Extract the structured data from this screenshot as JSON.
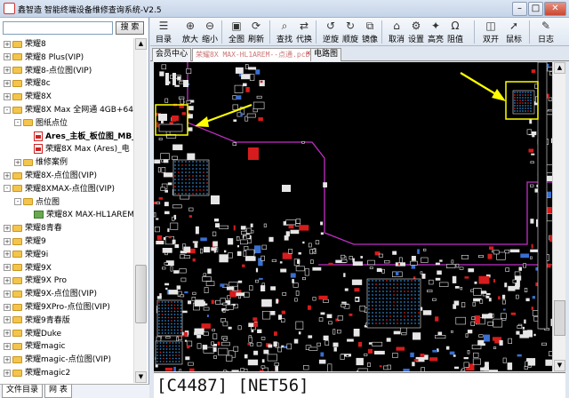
{
  "window": {
    "title": "鑫智造 智能终端设备维修查询系统-V2.5",
    "controls": {
      "minimize": "–",
      "maximize": "□",
      "close": "✕"
    }
  },
  "sidebar": {
    "search_placeholder": "",
    "search_button": "搜 索",
    "tree": [
      {
        "label": "荣耀8",
        "indent": 0,
        "icon": "folder",
        "expand": "+"
      },
      {
        "label": "荣耀8 Plus(VIP)",
        "indent": 0,
        "icon": "folder",
        "expand": "+"
      },
      {
        "label": "荣耀8-点位图(VIP)",
        "indent": 0,
        "icon": "folder",
        "expand": "+"
      },
      {
        "label": "荣耀8c",
        "indent": 0,
        "icon": "folder",
        "expand": "+"
      },
      {
        "label": "荣耀8X",
        "indent": 0,
        "icon": "folder",
        "expand": "+"
      },
      {
        "label": "荣耀8X Max 全网通 4GB+64G",
        "indent": 0,
        "icon": "folder",
        "expand": "-"
      },
      {
        "label": "图纸点位",
        "indent": 1,
        "icon": "folder",
        "expand": "-"
      },
      {
        "label": "Ares_主板_板位图_MB_V",
        "indent": 2,
        "icon": "pdf",
        "expand": "",
        "bold": true
      },
      {
        "label": "荣耀8X Max (Ares)_电",
        "indent": 2,
        "icon": "pdf",
        "expand": ""
      },
      {
        "label": "维修案例",
        "indent": 1,
        "icon": "folder",
        "expand": "+"
      },
      {
        "label": "荣耀8X-点位图(VIP)",
        "indent": 0,
        "icon": "folder",
        "expand": "+"
      },
      {
        "label": "荣耀8XMAX-点位图(VIP)",
        "indent": 0,
        "icon": "folder",
        "expand": "-"
      },
      {
        "label": "点位图",
        "indent": 1,
        "icon": "folder",
        "expand": "-"
      },
      {
        "label": "荣耀8X MAX-HL1AREM",
        "indent": 2,
        "icon": "pcb",
        "expand": ""
      },
      {
        "label": "荣耀8青春",
        "indent": 0,
        "icon": "folder",
        "expand": "+"
      },
      {
        "label": "荣耀9",
        "indent": 0,
        "icon": "folder",
        "expand": "+"
      },
      {
        "label": "荣耀9i",
        "indent": 0,
        "icon": "folder",
        "expand": "+"
      },
      {
        "label": "荣耀9X",
        "indent": 0,
        "icon": "folder",
        "expand": "+"
      },
      {
        "label": "荣耀9X Pro",
        "indent": 0,
        "icon": "folder",
        "expand": "+"
      },
      {
        "label": "荣耀9X-点位图(VIP)",
        "indent": 0,
        "icon": "folder",
        "expand": "+"
      },
      {
        "label": "荣耀9XPro-点位图(VIP)",
        "indent": 0,
        "icon": "folder",
        "expand": "+"
      },
      {
        "label": "荣耀9青春版",
        "indent": 0,
        "icon": "folder",
        "expand": "+"
      },
      {
        "label": "荣耀Duke",
        "indent": 0,
        "icon": "folder",
        "expand": "+"
      },
      {
        "label": "荣耀magic",
        "indent": 0,
        "icon": "folder",
        "expand": "+"
      },
      {
        "label": "荣耀magic-点位图(VIP)",
        "indent": 0,
        "icon": "folder",
        "expand": "+"
      },
      {
        "label": "荣耀magic2",
        "indent": 0,
        "icon": "folder",
        "expand": "+"
      }
    ],
    "tabs": [
      "文件目录",
      "网 表"
    ]
  },
  "toolbar": {
    "buttons": [
      {
        "label": "目录",
        "icon": "list-icon"
      },
      {
        "label": "放大",
        "icon": "zoom-in-icon"
      },
      {
        "label": "缩小",
        "icon": "zoom-out-icon"
      },
      {
        "label": "全图",
        "icon": "fit-icon"
      },
      {
        "label": "刷新",
        "icon": "refresh-icon"
      },
      {
        "label": "查找",
        "icon": "find-icon"
      },
      {
        "label": "代换",
        "icon": "replace-icon"
      },
      {
        "label": "逆旋",
        "icon": "rotate-ccw-icon"
      },
      {
        "label": "顺旋",
        "icon": "rotate-cw-icon"
      },
      {
        "label": "镜像",
        "icon": "mirror-icon"
      },
      {
        "label": "取消",
        "icon": "cancel-icon"
      },
      {
        "label": "设置",
        "icon": "settings-icon"
      },
      {
        "label": "高亮",
        "icon": "highlight-icon"
      },
      {
        "label": "阻值",
        "icon": "resistance-icon"
      },
      {
        "label": "双开",
        "icon": "split-icon"
      },
      {
        "label": "鼠标",
        "icon": "mouse-icon"
      },
      {
        "label": "日志",
        "icon": "log-icon"
      }
    ]
  },
  "doc_tabs": [
    "会员中心",
    "荣耀8X MAX-HL1AREM--点通.pcb",
    "电路图"
  ],
  "status_bar": "[C4487] [NET56]",
  "colors": {
    "board_bg": "#000000",
    "outline": "#c12ec5",
    "highlight": "#ffff00",
    "pad": "#e6e6e6",
    "red": "#d61c1c"
  }
}
